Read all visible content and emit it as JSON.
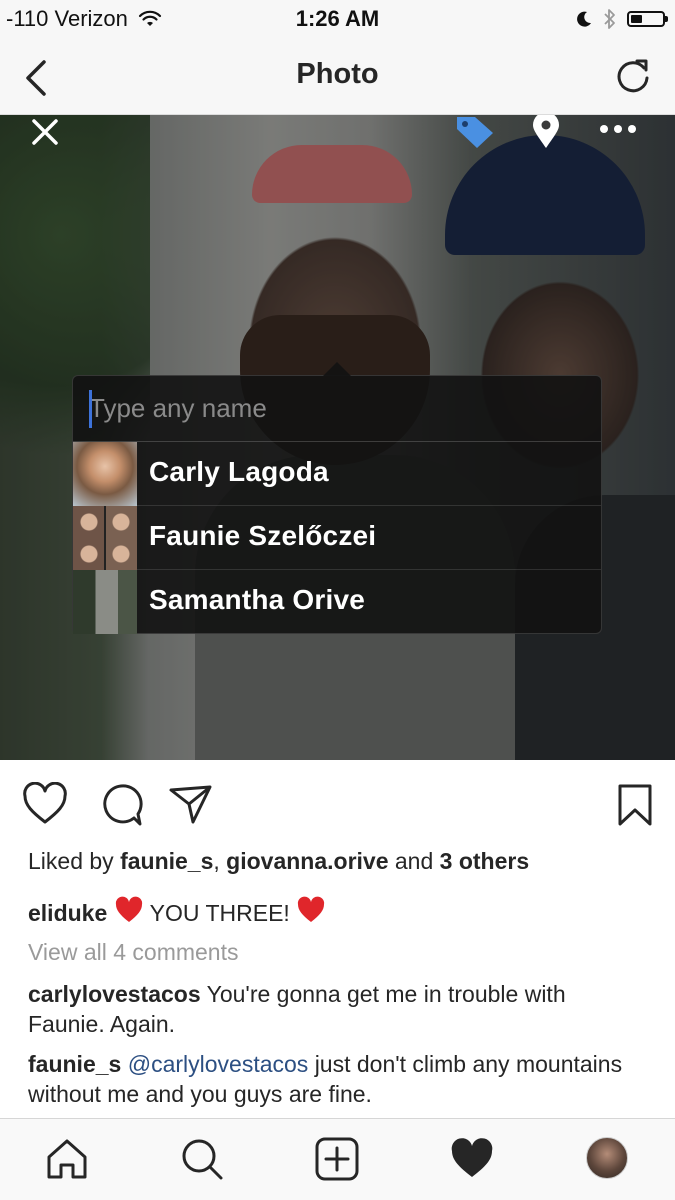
{
  "status_bar": {
    "carrier": "-110 Verizon",
    "time": "1:26 AM",
    "battery_level": 0.35,
    "icons": [
      "wifi-icon",
      "moon-icon",
      "bluetooth-icon",
      "battery-icon"
    ]
  },
  "nav": {
    "title": "Photo",
    "back_icon": "chevron-left-icon",
    "refresh_icon": "refresh-icon"
  },
  "photo_overlay": {
    "icons": [
      "close-icon",
      "tag-icon",
      "location-pin-icon",
      "more-icon"
    ]
  },
  "tag_popup": {
    "placeholder": "Type any name",
    "suggestions": [
      {
        "name": "Carly Lagoda"
      },
      {
        "name": "Faunie Szelőczei"
      },
      {
        "name": "Samantha Orive"
      }
    ]
  },
  "actions": {
    "icons": [
      "heart-outline-icon",
      "comment-icon",
      "share-icon",
      "bookmark-icon"
    ]
  },
  "likes": {
    "prefix": "Liked by",
    "user1": "faunie_s",
    "separator": ",",
    "user2": "giovanna.orive",
    "and": "and",
    "others": "3 others"
  },
  "caption": {
    "user": "eliduke",
    "text": "YOU THREE!"
  },
  "view_all_comments": "View all 4 comments",
  "comments": [
    {
      "user": "carlylovestacos",
      "mention": "",
      "text": "You're gonna get me in trouble with Faunie. Again."
    },
    {
      "user": "faunie_s",
      "mention": "@carlylovestacos",
      "text": "just don't climb any mountains without me and you guys are fine."
    }
  ],
  "tab_bar": {
    "icons": [
      "home-icon",
      "search-icon",
      "add-post-icon",
      "activity-heart-icon",
      "profile-avatar"
    ]
  },
  "colors": {
    "accent_blue": "#3d72d9",
    "tag_blue": "#4a90e2",
    "like_red": "#e0262b",
    "mention": "#2c4f82",
    "muted": "#9a9a9a"
  }
}
